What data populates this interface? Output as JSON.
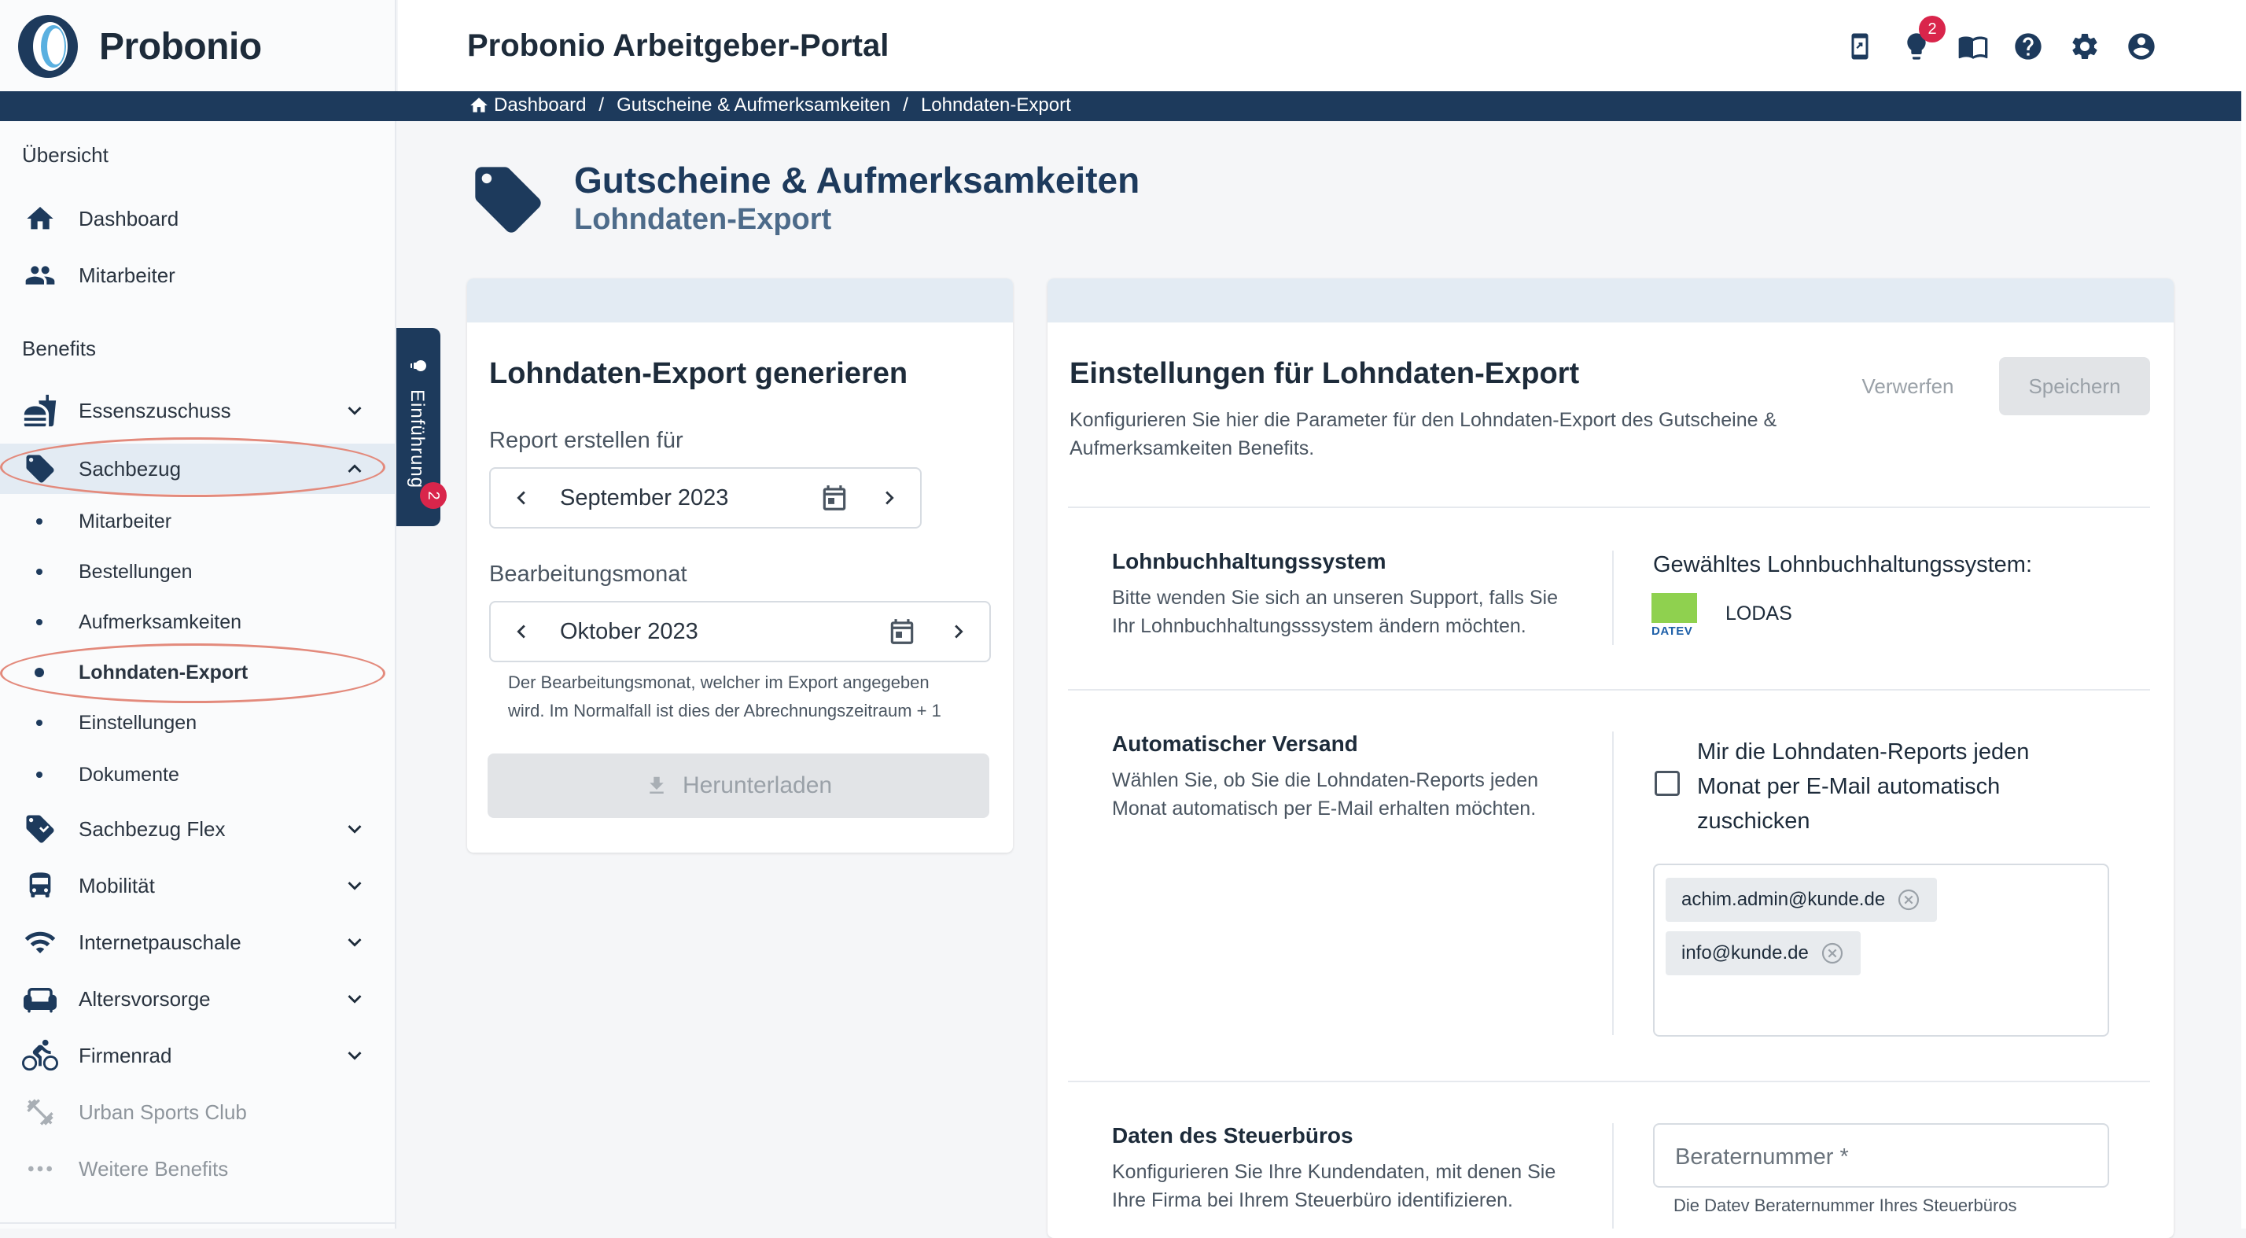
{
  "app": {
    "logo_text": "Probonio",
    "portal_title": "Probonio Arbeitgeber-Portal",
    "notification_count": "2"
  },
  "breadcrumb": [
    "Dashboard",
    "Gutscheine & Aufmerksamkeiten",
    "Lohndaten-Export"
  ],
  "sidebar": {
    "section_overview": "Übersicht",
    "section_benefits": "Benefits",
    "overview_items": [
      {
        "label": "Dashboard",
        "icon": "home-icon"
      },
      {
        "label": "Mitarbeiter",
        "icon": "people-icon"
      }
    ],
    "benefit_items": [
      {
        "label": "Essenszuschuss",
        "icon": "food-icon"
      },
      {
        "label": "Sachbezug",
        "icon": "tag-icon"
      },
      {
        "label": "Sachbezug Flex",
        "icon": "tag-flex-icon"
      },
      {
        "label": "Mobilität",
        "icon": "bus-icon"
      },
      {
        "label": "Internetpauschale",
        "icon": "wifi-icon"
      },
      {
        "label": "Altersvorsorge",
        "icon": "sofa-icon"
      },
      {
        "label": "Firmenrad",
        "icon": "bicycle-icon"
      },
      {
        "label": "Urban Sports Club",
        "icon": "dumbbell-icon"
      },
      {
        "label": "Weitere Benefits",
        "icon": "more-icon"
      }
    ],
    "sachbezug_sub": [
      "Mitarbeiter",
      "Bestellungen",
      "Aufmerksamkeiten",
      "Lohndaten-Export",
      "Einstellungen",
      "Dokumente"
    ]
  },
  "intro_tab": {
    "label": "Einführung",
    "badge": "2"
  },
  "page": {
    "title": "Gutscheine & Aufmerksamkeiten",
    "subtitle": "Lohndaten-Export"
  },
  "export_card": {
    "title": "Lohndaten-Export generieren",
    "report_label": "Report erstellen für",
    "report_value": "September 2023",
    "processing_label": "Bearbeitungsmonat",
    "processing_value": "Oktober 2023",
    "processing_hint_1": "Der Bearbeitungsmonat, welcher im Export angegeben",
    "processing_hint_2": "wird. Im Normalfall ist dies der Abrechnungszeitraum + 1",
    "download_label": "Herunterladen"
  },
  "settings_card": {
    "title": "Einstellungen für Lohndaten-Export",
    "desc_1": "Konfigurieren Sie hier die Parameter für den Lohndaten-Export des Gutscheine &",
    "desc_2": "Aufmerksamkeiten Benefits.",
    "discard_label": "Verwerfen",
    "save_label": "Speichern",
    "payroll": {
      "heading": "Lohnbuchhaltungssystem",
      "desc_1": "Bitte wenden Sie sich an unseren Support, falls Sie",
      "desc_2": "Ihr Lohnbuchhaltungsssystem ändern möchten.",
      "selected_label": "Gewähltes Lohnbuchhaltungssystem:",
      "logo_text": "DATEV",
      "system": "LODAS"
    },
    "auto_send": {
      "heading": "Automatischer Versand",
      "desc_1": "Wählen Sie, ob Sie die Lohndaten-Reports jeden",
      "desc_2": "Monat automatisch per E-Mail erhalten möchten.",
      "checkbox_label_1": "Mir die Lohndaten-Reports jeden",
      "checkbox_label_2": "Monat per E-Mail automatisch",
      "checkbox_label_3": "zuschicken",
      "emails": [
        "achim.admin@kunde.de",
        "info@kunde.de"
      ]
    },
    "tax_office": {
      "heading": "Daten des Steuerbüros",
      "desc_1": "Konfigurieren Sie Ihre Kundendaten, mit denen Sie",
      "desc_2": "Ihre Firma bei Ihrem Steuerbüro identifizieren.",
      "input_placeholder": "Beraternummer *",
      "input_hint": "Die Datev Beraternummer Ihres Steuerbüros"
    }
  },
  "colors": {
    "primary": "#1d3a5c",
    "active_bg": "#e3ebf3",
    "badge": "#d9254b",
    "highlight_ellipse": "#e38a7c",
    "datev_green": "#8fd14f"
  }
}
